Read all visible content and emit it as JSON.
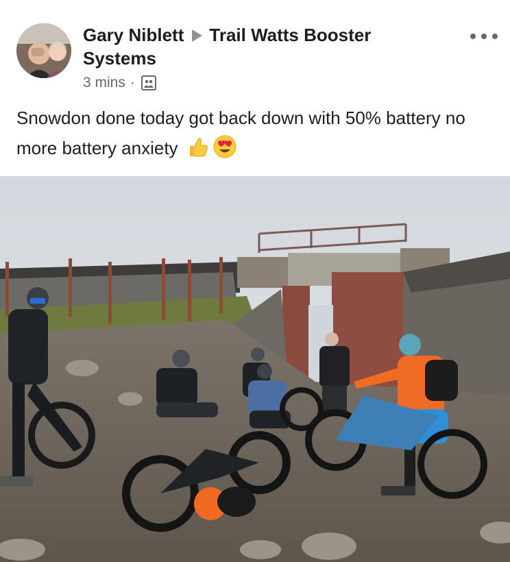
{
  "author": {
    "name": "Gary Niblett",
    "group": "Trail Watts Booster Systems",
    "avatar_icon": "profile-photo-icon"
  },
  "meta": {
    "time": "3 mins",
    "separator": "·",
    "audience_icon": "public-audience-icon"
  },
  "post": {
    "text": "Snowdon done today got back down with 50% battery no more battery anxiety",
    "emojis": [
      "thumbs-up-emoji",
      "heart-eyes-emoji"
    ]
  },
  "photo": {
    "icon": "mountain-bike-group-photo"
  },
  "colors": {
    "text": "#1c1e21",
    "secondary": "#65676b",
    "sky": "#d6dbe0"
  }
}
